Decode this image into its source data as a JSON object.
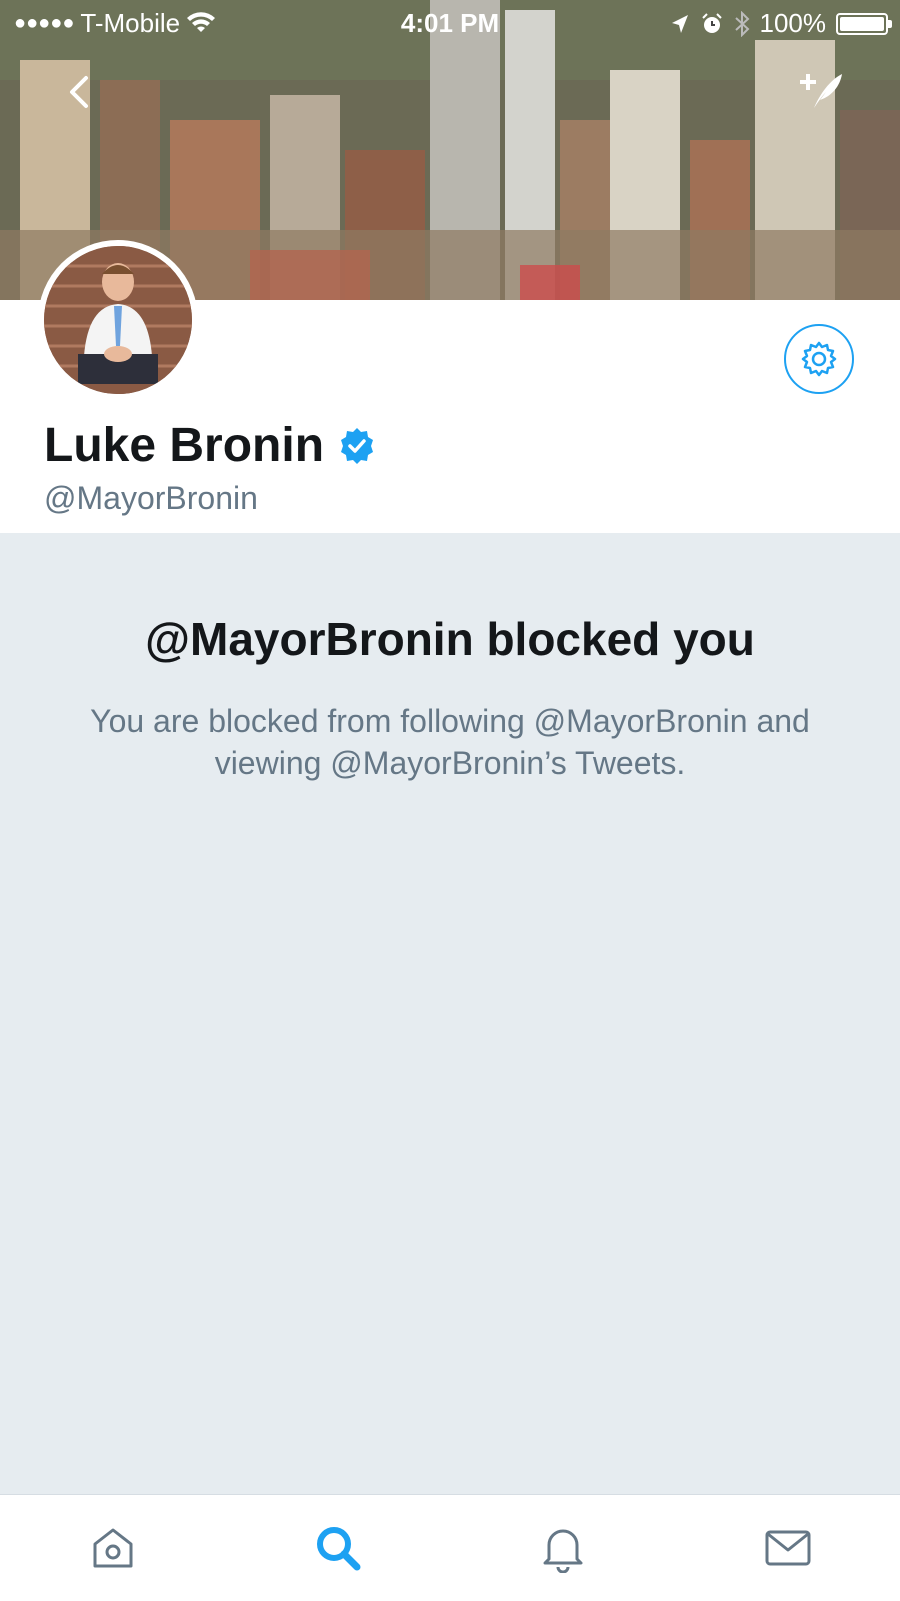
{
  "status_bar": {
    "signal_dots": "●●●●●",
    "carrier": "T-Mobile",
    "time": "4:01 PM",
    "battery_text": "100%",
    "battery_level": 1.0,
    "icons": [
      "wifi-icon",
      "location-icon",
      "alarm-icon",
      "bluetooth-icon",
      "battery-icon"
    ]
  },
  "header": {
    "back_icon": "chevron-left-icon",
    "compose_icon": "compose-tweet-icon"
  },
  "profile": {
    "display_name": "Luke Bronin",
    "verified": true,
    "handle": "@MayorBronin",
    "settings_icon": "gear-icon"
  },
  "blocked": {
    "title": "@MayorBronin blocked you",
    "message": "You are blocked from following @MayorBronin and viewing @MayorBronin’s Tweets."
  },
  "tabbar": {
    "items": [
      {
        "name": "home",
        "icon": "home-icon",
        "active": false
      },
      {
        "name": "search",
        "icon": "search-icon",
        "active": true
      },
      {
        "name": "notifications",
        "icon": "bell-icon",
        "active": false
      },
      {
        "name": "messages",
        "icon": "mail-icon",
        "active": false
      }
    ]
  },
  "colors": {
    "accent": "#1da1f2",
    "text_primary": "#14171a",
    "text_secondary": "#657786",
    "background": "#e6ecf0",
    "inactive_icon": "#657786"
  }
}
